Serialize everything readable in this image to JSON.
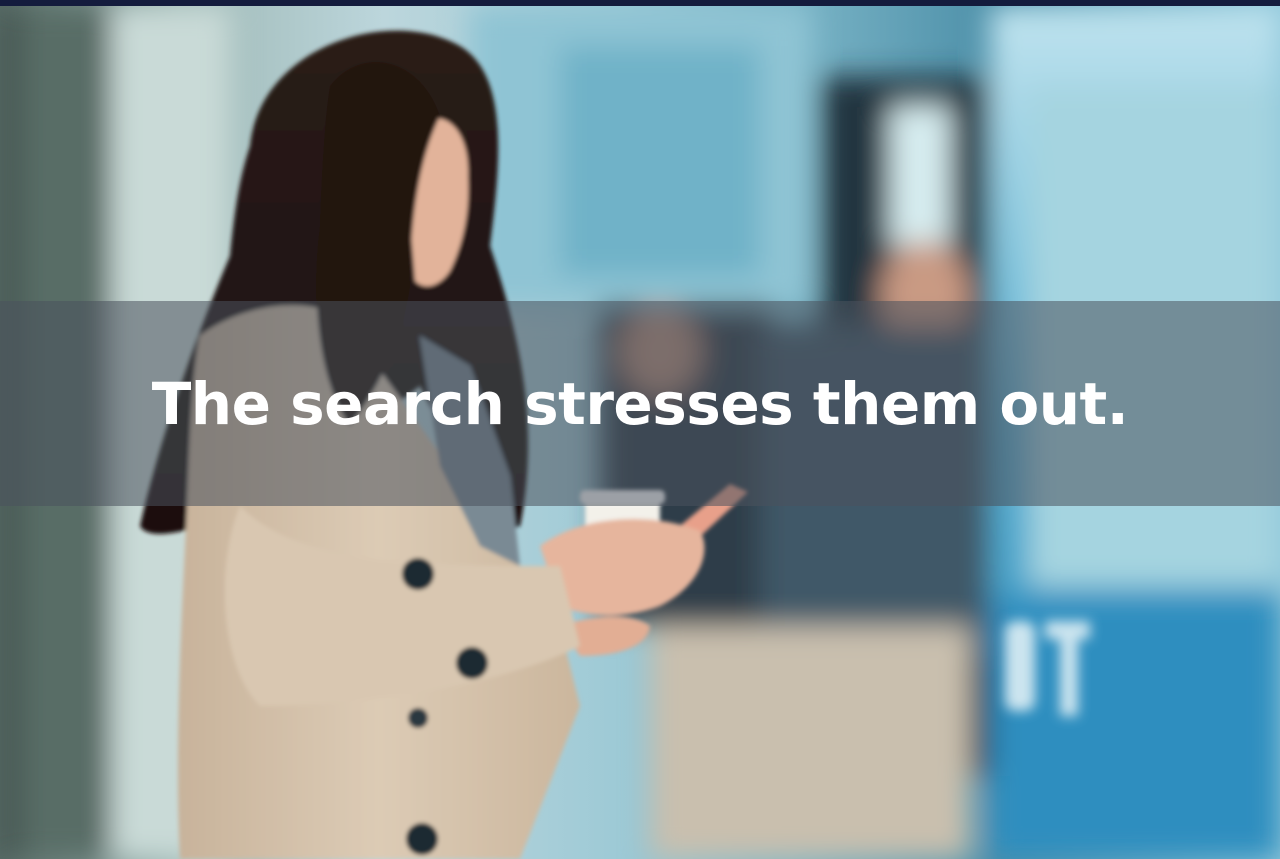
{
  "slide": {
    "caption": "The search stresses them out."
  },
  "photo": {
    "description_icon": "woman-with-phone-photo"
  },
  "colors": {
    "top_bar": "#141c3d",
    "caption_band": "#4b525c",
    "caption_text": "#ffffff",
    "bus_blue": "#2f8fbf",
    "coat": "#d6c4ad"
  }
}
